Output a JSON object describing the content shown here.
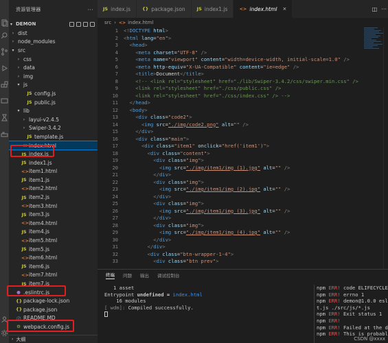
{
  "activity_bar": {
    "icons": [
      "files-icon",
      "search-icon",
      "source-control-icon",
      "run-debug-icon",
      "extensions-icon",
      "remote-icon",
      "test-icon",
      "docker-icon",
      "account-icon",
      "settings-icon"
    ]
  },
  "sidebar": {
    "title": "资源管理器",
    "more": "···",
    "project": "DEMON",
    "footer": "大纲",
    "items": [
      {
        "label": "dist",
        "type": "folder",
        "depth": 1,
        "open": false
      },
      {
        "label": "node_modules",
        "type": "folder",
        "depth": 1,
        "open": false
      },
      {
        "label": "src",
        "type": "folder",
        "depth": 1,
        "open": true
      },
      {
        "label": "css",
        "type": "folder",
        "depth": 2,
        "open": false
      },
      {
        "label": "data",
        "type": "folder",
        "depth": 2,
        "open": false
      },
      {
        "label": "img",
        "type": "folder",
        "depth": 2,
        "open": false
      },
      {
        "label": "js",
        "type": "folder",
        "depth": 2,
        "open": true
      },
      {
        "label": "config.js",
        "type": "js",
        "depth": 3
      },
      {
        "label": "public.js",
        "type": "js",
        "depth": 3
      },
      {
        "label": "lib",
        "type": "folder",
        "depth": 2,
        "open": true
      },
      {
        "label": "layui-v2.4.5",
        "type": "folder",
        "depth": 3,
        "open": false
      },
      {
        "label": "Swiper-3.4.2",
        "type": "folder",
        "depth": 3,
        "open": false
      },
      {
        "label": "template.js",
        "type": "js",
        "depth": 3
      },
      {
        "label": "index.html",
        "type": "html",
        "depth": 2,
        "selected": true
      },
      {
        "label": "index.js",
        "type": "js",
        "depth": 2
      },
      {
        "label": "index1.js",
        "type": "js",
        "depth": 2
      },
      {
        "label": "item1.html",
        "type": "html",
        "depth": 2
      },
      {
        "label": "item1.js",
        "type": "js",
        "depth": 2
      },
      {
        "label": "item2.html",
        "type": "html",
        "depth": 2
      },
      {
        "label": "item2.js",
        "type": "js",
        "depth": 2
      },
      {
        "label": "item3.html",
        "type": "html",
        "depth": 2
      },
      {
        "label": "item3.js",
        "type": "js",
        "depth": 2
      },
      {
        "label": "item4.html",
        "type": "html",
        "depth": 2
      },
      {
        "label": "item4.js",
        "type": "js",
        "depth": 2
      },
      {
        "label": "item5.html",
        "type": "html",
        "depth": 2
      },
      {
        "label": "item5.js",
        "type": "js",
        "depth": 2
      },
      {
        "label": "item6.html",
        "type": "html",
        "depth": 2
      },
      {
        "label": "item6.js",
        "type": "js",
        "depth": 2
      },
      {
        "label": "item7.html",
        "type": "html",
        "depth": 2
      },
      {
        "label": "item7.js",
        "type": "js",
        "depth": 2
      },
      {
        "label": ".eslintrc.js",
        "type": "dot",
        "depth": 1
      },
      {
        "label": "package-lock.json",
        "type": "json",
        "depth": 1
      },
      {
        "label": "package.json",
        "type": "json",
        "depth": 1
      },
      {
        "label": "README.MD",
        "type": "md",
        "depth": 1
      },
      {
        "label": "webpack.config.js",
        "type": "cfg",
        "depth": 1
      }
    ]
  },
  "tabs": [
    {
      "label": "index.js",
      "type": "js",
      "active": false
    },
    {
      "label": "package.json",
      "type": "json",
      "active": false
    },
    {
      "label": "index1.js",
      "type": "js",
      "active": false
    },
    {
      "label": "index.html",
      "type": "html",
      "active": true,
      "close": "×"
    }
  ],
  "breadcrumb": {
    "folder": "src",
    "file": "index.html",
    "sep": "›"
  },
  "editor": {
    "start_line": 1,
    "lines": [
      "<!DOCTYPE html>",
      "<html lang=\"en\">",
      "  <head>",
      "    <meta charset=\"UTF-8\" />",
      "    <meta name=\"viewport\" content=\"width=device-width, initial-scale=1.0\" />",
      "    <meta http-equiv=\"X-UA-Compatible\" content=\"ie=edge\" />",
      "    <title>Document</title>",
      "    <!-- <link rel=\"stylesheet\" href=\"./lib/Swiper-3.4.2/css/swiper.min.css\" />",
      "    <link rel=\"stylesheet\" href=\"./css/public.css\" />",
      "    <link rel=\"stylesheet\" href=\"./css/index.css\" /> -->",
      "  </head>",
      "  <body>",
      "    <div class=\"code2\">",
      "      <img src=\"./img/code2.png\" alt=\"\" />",
      "    </div>",
      "    <div class=\"main\">",
      "      <div class=\"item1\" onclick=\"href('item1')\">",
      "        <div class=\"content\">",
      "          <div class=\"img\">",
      "            <img src=\"./img/item1/img (1).jpg\" alt=\"\" />",
      "          </div>",
      "          <div class=\"img\">",
      "            <img src=\"./img/item1/img (2).jpg\" alt=\"\" />",
      "          </div>",
      "          <div class=\"img\">",
      "            <img src=\"./img/item1/img (3).jpg\" alt=\"\" />",
      "          </div>",
      "          <div class=\"img\">",
      "            <img src=\"./img/item1/img (4).jpg\" alt=\"\" />",
      "          </div>",
      "        </div>",
      "        <div class=\"btn-wrapper-1-4\">",
      "          <div class=\"btn prev\">"
    ],
    "comment_lines": [
      8,
      9,
      10
    ]
  },
  "panel": {
    "tabs": [
      "终端",
      "问题",
      "输出",
      "调试控制台"
    ],
    "active_tab": 0,
    "terminal_left": [
      {
        "text": "   1 asset"
      },
      {
        "text": "Entrypoint ",
        "rest": "undefined = ",
        "hl": "index.html"
      },
      {
        "text": "    16 modules"
      },
      {
        "text": "[ wdm]: Compiled successfully.",
        "dim": "[ wdm]: ",
        "body": "Compiled successfully."
      }
    ],
    "terminal_right": [
      {
        "pre": "npm ",
        "err": "ERR!",
        "post": " code ELIFECYCLE"
      },
      {
        "pre": "npm ",
        "err": "ERR!",
        "post": " errno 1"
      },
      {
        "pre": "npm ",
        "err": "ERR!",
        "post": " demon@1.0.0 esl"
      },
      {
        "pre": "t.js ./src/js/*.js",
        "err": "",
        "post": ""
      },
      {
        "pre": "npm ",
        "err": "ERR!",
        "post": " Exit status 1"
      },
      {
        "pre": "npm ",
        "err": "ERR!",
        "post": ""
      },
      {
        "pre": "npm ",
        "err": "ERR!",
        "post": " Failed at the d"
      },
      {
        "pre": "npm ",
        "err": "ERR!",
        "post": " This is probably"
      }
    ],
    "watermark": "CSDN @xxxx"
  },
  "colors": {
    "accent": "#007fd4",
    "highlight_box": "#e02020"
  }
}
